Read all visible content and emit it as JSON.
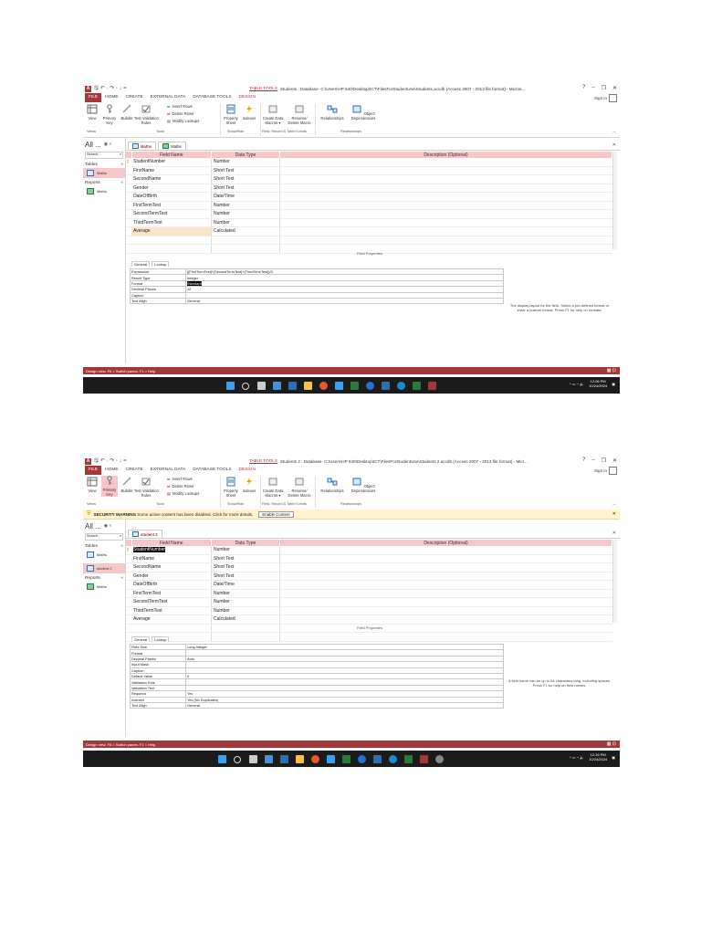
{
  "common": {
    "qa_glyphs": "🖫 ↶ · ↷ · ↓ =",
    "table_tools": "TABLE TOOLS",
    "tabs": [
      "FILE",
      "HOME",
      "CREATE",
      "EXTERNAL DATA",
      "DATABASE TOOLS",
      "DESIGN"
    ],
    "sign_in": "Sign in",
    "ribbon": {
      "view": "View",
      "primary_key": "Primary\nKey",
      "builder": "Builder",
      "test_validation": "Test Validation\nRules",
      "insert_rows": "Insert Rows",
      "delete_rows": "Delete Rows",
      "modify_lookups": "Modify Lookups",
      "property_sheet": "Property\nSheet",
      "indexes": "Indexes",
      "create_data_macros": "Create Data\nMacros ▾",
      "rename_delete_macro": "Rename/\nDelete Macro",
      "relationships": "Relationships",
      "object_dependencies": "Object\nDependencies",
      "groups": [
        "Views",
        "Tools",
        "Show/Hide",
        "Field, Record & Table Events",
        "Relationships"
      ]
    },
    "nav": {
      "title": "All ...",
      "search_placeholder": "Search...",
      "tables_group": "Tables",
      "reports_group": "Reports"
    },
    "grid_headers": [
      "Field Name",
      "Data Type",
      "Description (Optional)"
    ],
    "field_properties_label": "Field Properties",
    "fp_tabs": [
      "General",
      "Lookup"
    ],
    "status_text": "Design view.  F6 = Switch panes.  F1 = Help."
  },
  "screenshot1": {
    "window_title": "Students : Database- C:\\Users\\HP 840\\Desktop\\ICT\\FilesForStudentUse\\Students.accdb (Access 2007 - 2013 file format) - Micros...",
    "nav_table": "Maths",
    "nav_report": "Maths",
    "doc_tabs": [
      "Maths",
      "Maths"
    ],
    "fields": [
      {
        "name": "StudentNumber",
        "type": "Number",
        "key": true
      },
      {
        "name": "FirstName",
        "type": "Short Text"
      },
      {
        "name": "SecondName",
        "type": "Short Text"
      },
      {
        "name": "Gender",
        "type": "Short Text"
      },
      {
        "name": "DateOfBirth",
        "type": "Date/Time"
      },
      {
        "name": "FirstTermTest",
        "type": "Number"
      },
      {
        "name": "SecondTermTest",
        "type": "Number"
      },
      {
        "name": "ThirdTermTest",
        "type": "Number"
      },
      {
        "name": "Average",
        "type": "Calculated",
        "current": true
      }
    ],
    "properties": [
      [
        "Expression",
        "([FirstTermTest]+[SecondTermTest]+[ThirdTermTest])/3"
      ],
      [
        "Result Type",
        "Integer"
      ],
      [
        "Format",
        "Standard"
      ],
      [
        "Decimal Places",
        "12"
      ],
      [
        "Caption",
        ""
      ],
      [
        "Text Align",
        "General"
      ]
    ],
    "help_text": "The display layout for the field. Select a pre-defined format or enter a custom format. Press F1 for help on formats.",
    "clock_time": "12:06 PM",
    "clock_date": "10/24/2024"
  },
  "screenshot2": {
    "window_title": "Students 2 : Database- C:\\Users\\HP 840\\Desktop\\ICT\\FilesForStudentUse\\Students 2.accdb (Access 2007 - 2013 file format) - Micr...",
    "security_warning_label": "SECURITY WARNING",
    "security_warning_text": "Some active content has been disabled. Click for more details.",
    "enable_content": "Enable Content",
    "nav_table_1": "Maths",
    "nav_table_2": "student 2",
    "nav_report": "Maths",
    "doc_tabs": [
      "student 2"
    ],
    "fields": [
      {
        "name": "StudentNumber",
        "type": "Number",
        "key": true,
        "highlight": true
      },
      {
        "name": "FirstName",
        "type": "Short Text"
      },
      {
        "name": "SecondName",
        "type": "Short Text"
      },
      {
        "name": "Gender",
        "type": "Short Text"
      },
      {
        "name": "DateOfBirth",
        "type": "Date/Time"
      },
      {
        "name": "FirstTermTest",
        "type": "Number"
      },
      {
        "name": "SecondTermTest",
        "type": "Number"
      },
      {
        "name": "ThirdTermTest",
        "type": "Number"
      },
      {
        "name": "Average",
        "type": "Calculated"
      }
    ],
    "properties": [
      [
        "Field Size",
        "Long Integer"
      ],
      [
        "Format",
        ""
      ],
      [
        "Decimal Places",
        "Auto"
      ],
      [
        "Input Mask",
        ""
      ],
      [
        "Caption",
        ""
      ],
      [
        "Default Value",
        "0"
      ],
      [
        "Validation Rule",
        ""
      ],
      [
        "Validation Text",
        ""
      ],
      [
        "Required",
        "Yes"
      ],
      [
        "Indexed",
        "Yes (No Duplicates)"
      ],
      [
        "Text Align",
        "General"
      ]
    ],
    "help_text": "A field name can be up to 64 characters long, including spaces. Press F1 for help on field names.",
    "clock_time": "12:15 PM",
    "clock_date": "10/24/2024"
  },
  "colors": {
    "accent": "#a4373a",
    "header_pink": "#f6c6c8",
    "taskbar": "#1b1b1b"
  }
}
